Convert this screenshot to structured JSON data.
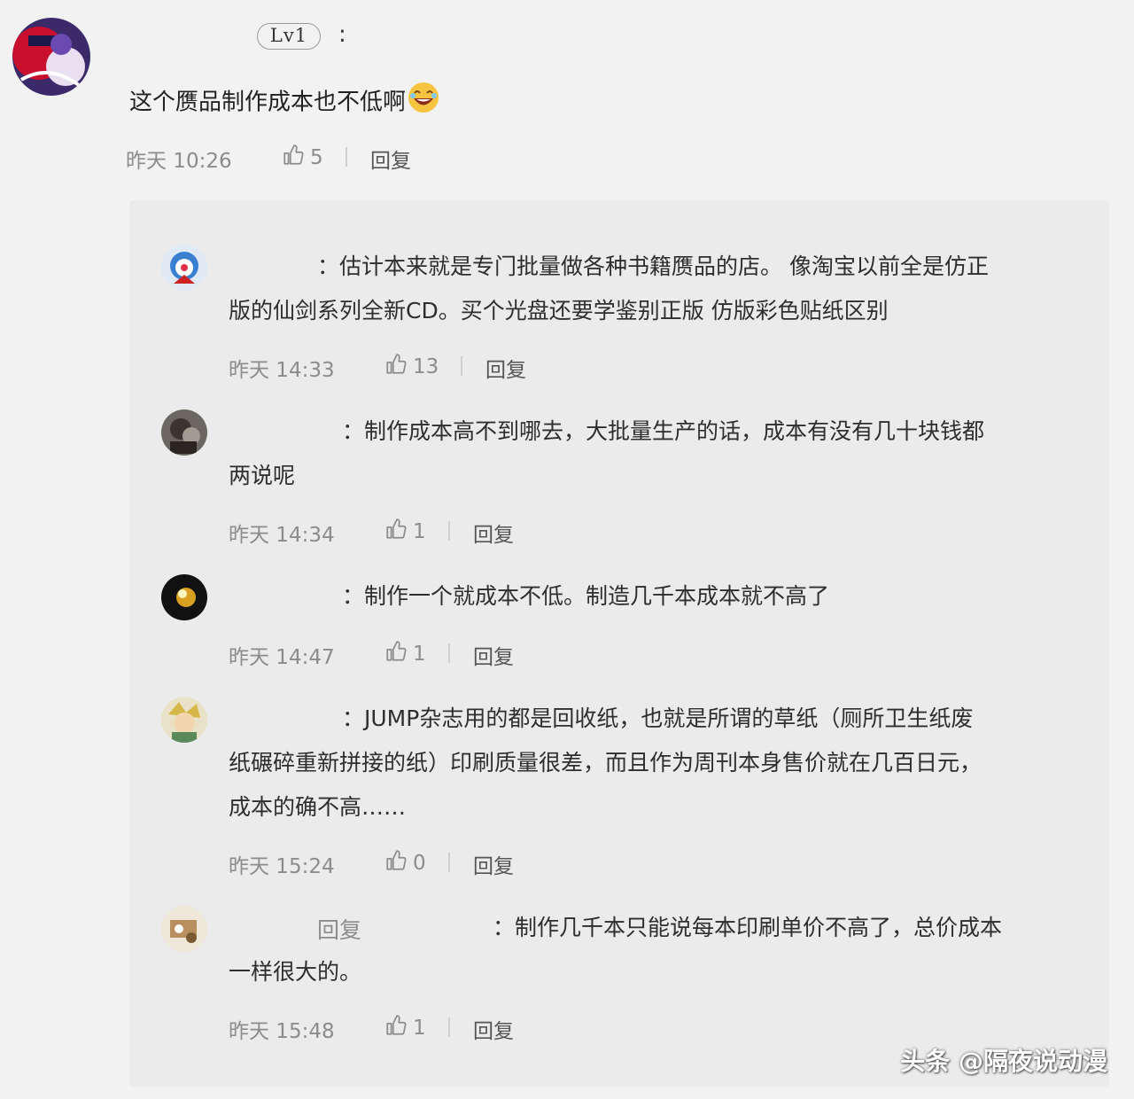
{
  "main_comment": {
    "level_badge": "Lv1",
    "colon": ":",
    "text": "这个赝品制作成本也不低啊",
    "emoji": "laughing-emoji",
    "time": "昨天 10:26",
    "likes": "5",
    "reply_label": "回复"
  },
  "replies": [
    {
      "colon": "：",
      "text_line1": "估计本来就是专门批量做各种书籍赝品的店。 像淘宝以前全是仿正",
      "text_line2": "版的仙剑系列全新CD。买个光盘还要学鉴别正版 仿版彩色贴纸区别",
      "time": "昨天 14:33",
      "likes": "13",
      "reply_label": "回复"
    },
    {
      "colon": "：",
      "text_line1": "制作成本高不到哪去，大批量生产的话，成本有没有几十块钱都",
      "text_line2": "两说呢",
      "time": "昨天 14:34",
      "likes": "1",
      "reply_label": "回复"
    },
    {
      "colon": "：",
      "text_line1": "制作一个就成本不低。制造几千本成本就不高了",
      "time": "昨天 14:47",
      "likes": "1",
      "reply_label": "回复"
    },
    {
      "colon": "：",
      "text_line1": "JUMP杂志用的都是回收纸，也就是所谓的草纸（厕所卫生纸废",
      "text_line2": "纸碾碎重新拼接的纸）印刷质量很差，而且作为周刊本身售价就在几百日元，",
      "text_line3": "成本的确不高……",
      "time": "昨天 15:24",
      "likes": "0",
      "reply_label": "回复"
    },
    {
      "reply_tag": "回复",
      "colon": "：",
      "text_line1": "制作几千本只能说每本印刷单价不高了，总价成本",
      "text_line2": "一样很大的。",
      "time": "昨天 15:48",
      "likes": "1",
      "reply_label": "回复"
    }
  ],
  "watermark": "头条 @隔夜说动漫",
  "colors": {
    "background": "#f2f2f3",
    "panel": "#ebebec",
    "meta_text": "#8c8c8c"
  }
}
